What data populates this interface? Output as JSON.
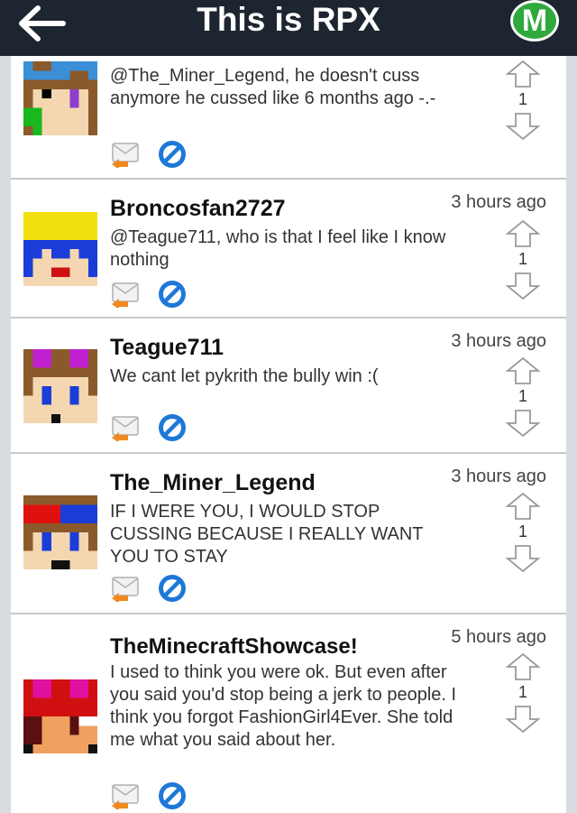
{
  "header": {
    "title": "This is RPX",
    "badge_letter": "M"
  },
  "comments": [
    {
      "author": "",
      "time": "",
      "text": "@The_Miner_Legend, he doesn't cuss anymore he cussed like 6 months ago -.-",
      "votes": "1",
      "avatar_colors": [
        "#3a8fd6",
        "#8b5a2b",
        "#f4d6b0",
        "#8e3cd0",
        "#19b81f"
      ]
    },
    {
      "author": "Broncosfan2727",
      "time": "3 hours ago",
      "text": "@Teague711, who is that I feel like I know nothing",
      "votes": "1",
      "avatar_colors": [
        "#f0e010",
        "#1a3cd8",
        "#f4d6b0",
        "#d01010"
      ]
    },
    {
      "author": "Teague711",
      "time": "3 hours ago",
      "text": "We cant let pykrith the bully win :(",
      "votes": "1",
      "avatar_colors": [
        "#c020d0",
        "#8b5a2b",
        "#f4d6b0",
        "#1a3cd8"
      ]
    },
    {
      "author": "The_Miner_Legend",
      "time": "3 hours ago",
      "text": "IF I WERE YOU, I WOULD STOP CUSSING BECAUSE I REALLY WANT YOU TO STAY",
      "votes": "1",
      "avatar_colors": [
        "#e01010",
        "#1a3cd8",
        "#8b5a2b",
        "#f4d6b0"
      ]
    },
    {
      "author": "TheMinecraftShowcase!",
      "time": "5 hours ago",
      "text": "I used to think you were ok. But even after you said you'd stop being a jerk to people. I think you forgot FashionGirl4Ever. She told me what you said about her.",
      "votes": "1",
      "avatar_colors": [
        "#e010a0",
        "#d01010",
        "#5a1010",
        "#f0a060"
      ]
    }
  ],
  "colors": {
    "topbar": "#1c2530",
    "badge": "#2fa93c",
    "reply_orange": "#f08a20",
    "block_blue": "#1f78d8"
  }
}
